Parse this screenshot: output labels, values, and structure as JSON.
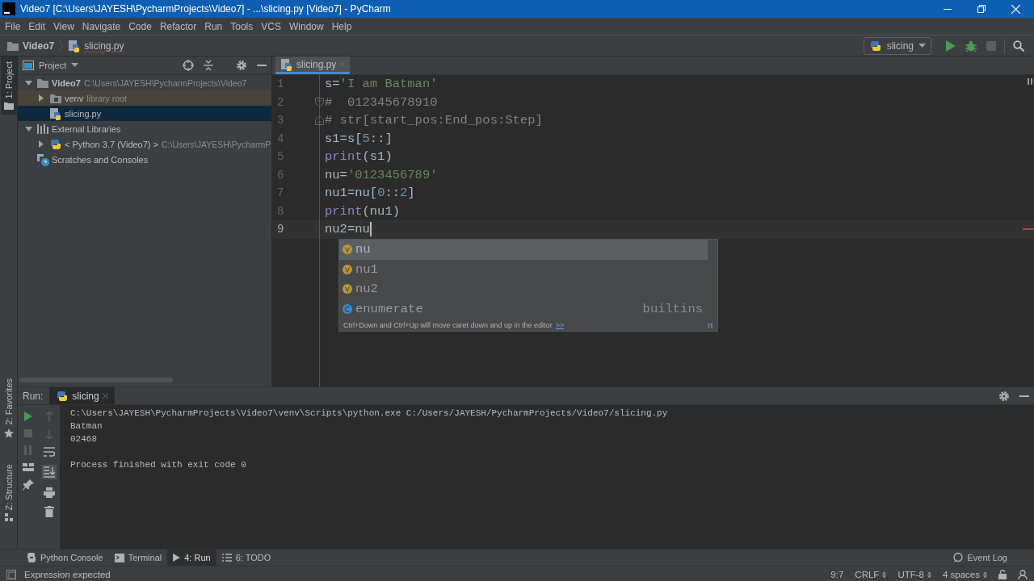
{
  "window": {
    "title": "Video7 [C:\\Users\\JAYESH\\PycharmProjects\\Video7] - ...\\slicing.py [Video7] - PyCharm"
  },
  "menu": [
    "File",
    "Edit",
    "View",
    "Navigate",
    "Code",
    "Refactor",
    "Run",
    "Tools",
    "VCS",
    "Window",
    "Help"
  ],
  "breadcrumbs": [
    {
      "label": "Video7",
      "kind": "folder"
    },
    {
      "label": "slicing.py",
      "kind": "python"
    }
  ],
  "run_config": {
    "label": "slicing"
  },
  "side_tabs_top": [
    {
      "label": "1: Project",
      "kind": "project",
      "selected": true
    }
  ],
  "side_tabs_bottom": [
    {
      "label": "2: Favorites",
      "kind": "favorites",
      "selected": false
    },
    {
      "label": "Z: Structure",
      "kind": "structure",
      "selected": false
    }
  ],
  "project": {
    "title": "Project",
    "tree": [
      {
        "label": "Video7",
        "kind": "root",
        "detail": "C:\\Users\\JAYESH\\PycharmProjects\\Video7",
        "expanded": true,
        "selected": false,
        "children": [
          {
            "label": "venv",
            "kind": "library-folder",
            "detail": "library root",
            "expanded": false,
            "selected": false
          },
          {
            "label": "slicing.py",
            "kind": "python",
            "selected": true
          }
        ]
      },
      {
        "label": "External Libraries",
        "kind": "libraries",
        "expanded": true,
        "selected": false,
        "children": [
          {
            "label": "< Python 3.7 (Video7) >",
            "kind": "sdk",
            "detail": "C:\\Users\\JAYESH\\PycharmP",
            "expanded": false,
            "selected": false
          }
        ]
      },
      {
        "label": "Scratches and Consoles",
        "kind": "scratches",
        "selected": false
      }
    ]
  },
  "editor": {
    "tabs": [
      {
        "label": "slicing.py",
        "selected": true
      }
    ],
    "lines": [
      {
        "number": "1",
        "current": false,
        "error": false,
        "fold_start": false,
        "fold_end": false,
        "tokens": [
          {
            "text": "s=",
            "kind": "plain"
          },
          {
            "text": "'I am Batman'",
            "kind": "string"
          }
        ]
      },
      {
        "number": "2",
        "current": false,
        "error": false,
        "fold_start": true,
        "fold_end": false,
        "tokens": [
          {
            "text": "#  012345678910",
            "kind": "comment"
          }
        ]
      },
      {
        "number": "3",
        "current": false,
        "error": false,
        "fold_start": false,
        "fold_end": true,
        "tokens": [
          {
            "text": "# str[start_pos:End_pos:Step]",
            "kind": "comment"
          }
        ]
      },
      {
        "number": "4",
        "current": false,
        "error": false,
        "fold_start": false,
        "fold_end": false,
        "tokens": [
          {
            "text": "s1=s[",
            "kind": "plain"
          },
          {
            "text": "5",
            "kind": "number"
          },
          {
            "text": "::]",
            "kind": "plain"
          }
        ]
      },
      {
        "number": "5",
        "current": false,
        "error": false,
        "fold_start": false,
        "fold_end": false,
        "tokens": [
          {
            "text": "print",
            "kind": "builtin"
          },
          {
            "text": "(s1)",
            "kind": "plain"
          }
        ]
      },
      {
        "number": "6",
        "current": false,
        "error": false,
        "fold_start": false,
        "fold_end": false,
        "tokens": [
          {
            "text": "nu=",
            "kind": "plain"
          },
          {
            "text": "'0123456789'",
            "kind": "string"
          }
        ]
      },
      {
        "number": "7",
        "current": false,
        "error": false,
        "fold_start": false,
        "fold_end": false,
        "tokens": [
          {
            "text": "nu1=nu[",
            "kind": "plain"
          },
          {
            "text": "0",
            "kind": "number"
          },
          {
            "text": "::",
            "kind": "plain"
          },
          {
            "text": "2",
            "kind": "number"
          },
          {
            "text": "]",
            "kind": "plain"
          }
        ]
      },
      {
        "number": "8",
        "current": false,
        "error": false,
        "fold_start": false,
        "fold_end": false,
        "tokens": [
          {
            "text": "print",
            "kind": "builtin"
          },
          {
            "text": "(nu1)",
            "kind": "plain"
          }
        ]
      },
      {
        "number": "9",
        "current": true,
        "error": true,
        "fold_start": false,
        "fold_end": false,
        "tokens": [
          {
            "text": "nu2=nu",
            "kind": "plain"
          }
        ]
      }
    ],
    "completion": {
      "items": [
        {
          "label": "nu",
          "kind": "variable",
          "selected": true
        },
        {
          "label": "nu1",
          "kind": "variable",
          "selected": false
        },
        {
          "label": "nu2",
          "kind": "variable",
          "selected": false
        },
        {
          "label": "enumerate",
          "kind": "class",
          "selected": false,
          "source": "builtins"
        }
      ],
      "hint": "Ctrl+Down and Ctrl+Up will move caret down and up in the editor",
      "hint_link": ">>",
      "corner_symbol": "π"
    }
  },
  "run": {
    "label": "Run:",
    "tabs": [
      {
        "label": "slicing",
        "selected": true
      }
    ],
    "output": [
      "C:\\Users\\JAYESH\\PycharmProjects\\Video7\\venv\\Scripts\\python.exe C:/Users/JAYESH/PycharmProjects/Video7/slicing.py",
      "Batman",
      "02468"
    ],
    "exit_message": "Process finished with exit code 0"
  },
  "tool_tabs": [
    {
      "label": "Python Console",
      "kind": "console",
      "selected": false
    },
    {
      "label": "Terminal",
      "kind": "terminal",
      "selected": false
    },
    {
      "label": "4: Run",
      "kind": "run",
      "selected": true
    },
    {
      "label": "6: TODO",
      "kind": "todo",
      "selected": false
    }
  ],
  "event_log": "Event Log",
  "status_bar": {
    "message": "Expression expected",
    "position": "9:7",
    "line_separator": "CRLF",
    "encoding": "UTF-8",
    "indent": "4 spaces"
  }
}
